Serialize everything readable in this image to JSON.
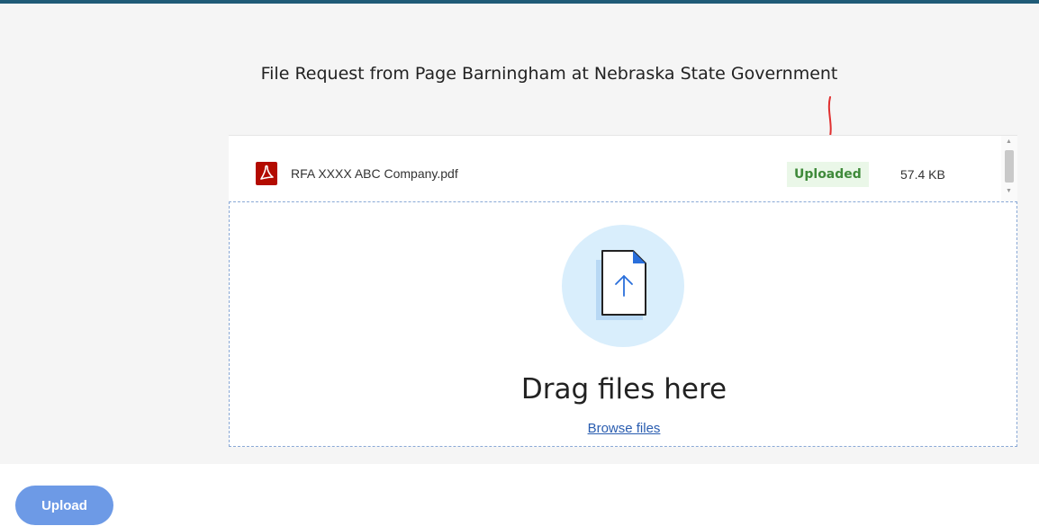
{
  "header": {
    "title": "File Request from Page Barningham at Nebraska State Government"
  },
  "file_list": {
    "items": [
      {
        "icon": "pdf-icon",
        "name": "RFA XXXX ABC Company.pdf",
        "status": "Uploaded",
        "size": "57.4 KB"
      }
    ]
  },
  "dropzone": {
    "icon": "file-upload-icon",
    "heading": "Drag files here",
    "browse_label": "Browse files"
  },
  "footer": {
    "upload_label": "Upload"
  },
  "colors": {
    "accent_bar": "#1f5b77",
    "upload_button": "#6d9ae6",
    "status_green": "#3f8a3a",
    "annotation_red": "#e03030"
  }
}
